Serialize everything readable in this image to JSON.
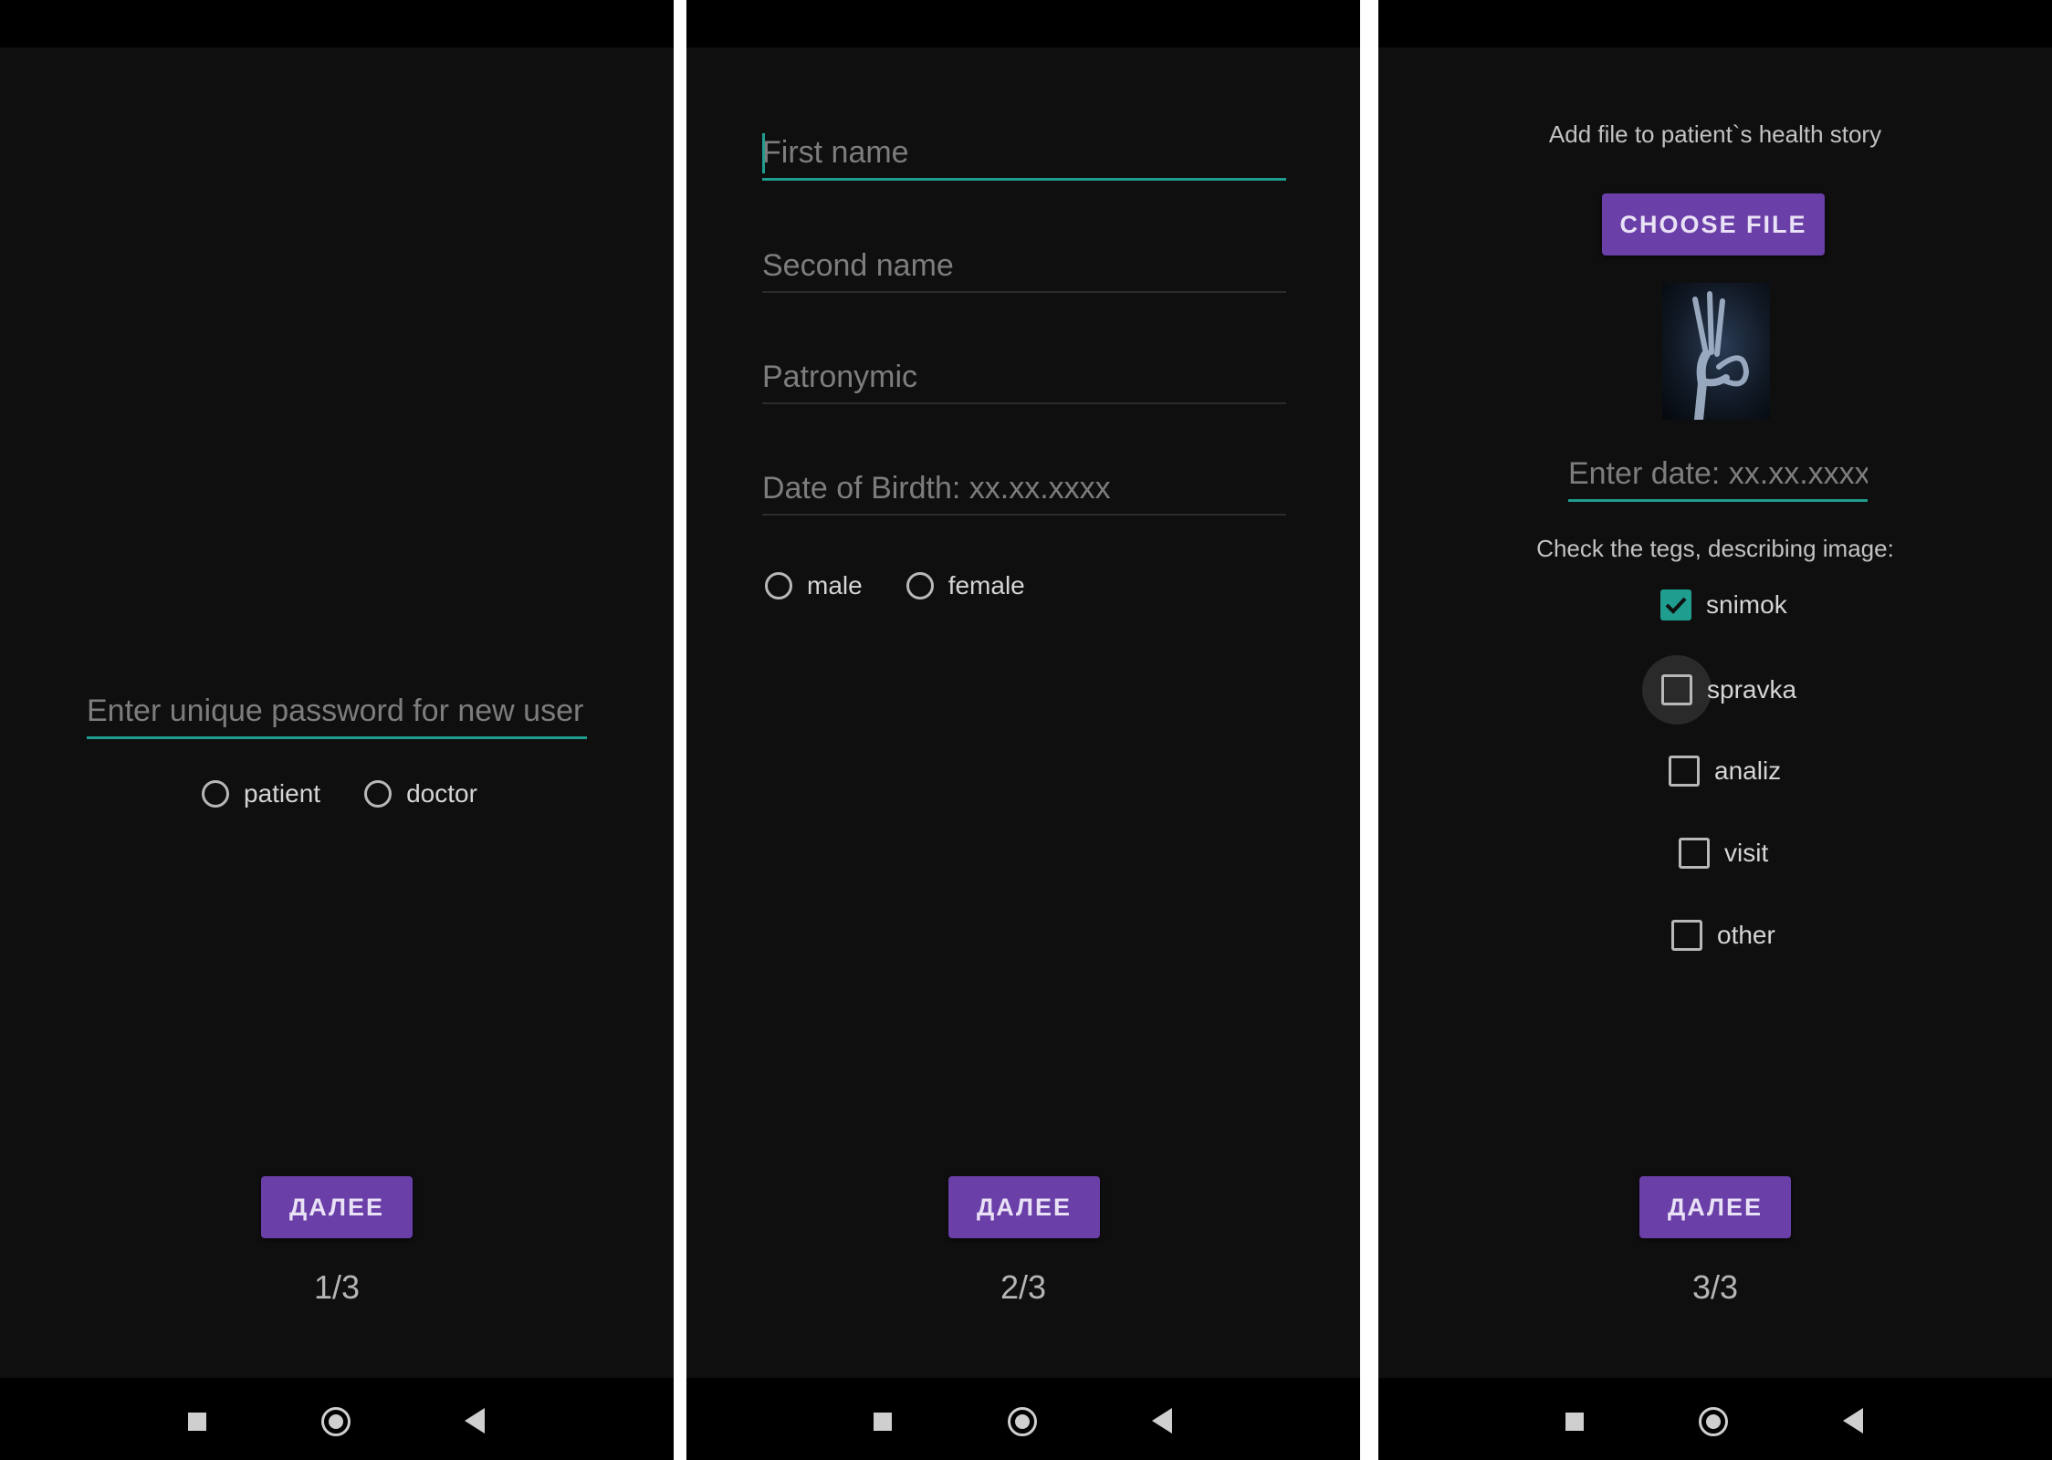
{
  "screen1": {
    "password_placeholder": "Enter unique password for new user",
    "role_options": [
      "patient",
      "doctor"
    ],
    "next_button": "ДАЛЕЕ",
    "pager": "1/3"
  },
  "screen2": {
    "first_name_placeholder": "First name",
    "second_name_placeholder": "Second name",
    "patronymic_placeholder": "Patronymic",
    "dob_placeholder": "Date of Birdth: xx.xx.xxxx",
    "gender_options": [
      "male",
      "female"
    ],
    "next_button": "ДАЛЕЕ",
    "pager": "2/3"
  },
  "screen3": {
    "caption": "Add file to patient`s health story",
    "choose_file_button": "CHOOSE FILE",
    "thumbnail_icon": "xray-hand-image",
    "date_placeholder": "Enter date: xx.xx.xxxx",
    "tags_caption": "Check the tegs, describing image:",
    "tags": [
      {
        "label": "snimok",
        "checked": true
      },
      {
        "label": "spravka",
        "checked": false
      },
      {
        "label": "analiz",
        "checked": false
      },
      {
        "label": "visit",
        "checked": false
      },
      {
        "label": "other",
        "checked": false
      }
    ],
    "next_button": "ДАЛЕЕ",
    "pager": "3/3"
  },
  "colors": {
    "background": "#0f0f10",
    "accent": "#1f9d8f",
    "button": "#6a3fa8",
    "text": "#d5d5d5",
    "hint": "#7d7d7d"
  },
  "nav_icons": [
    "recents-icon",
    "home-icon",
    "back-icon"
  ]
}
